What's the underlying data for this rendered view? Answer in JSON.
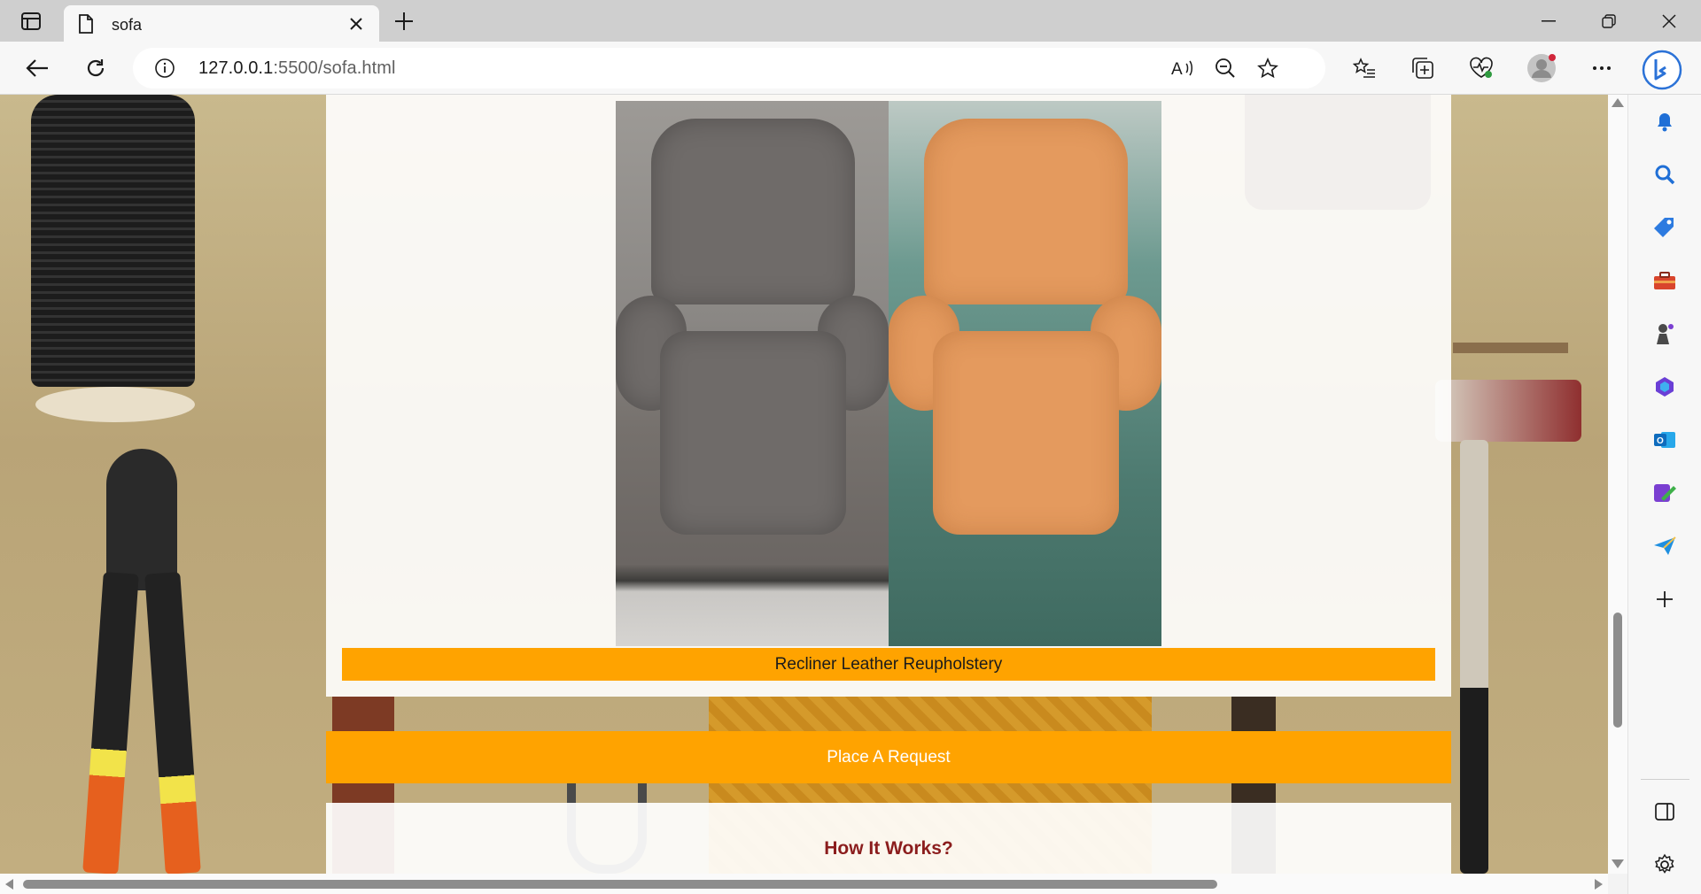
{
  "browser": {
    "tab_title": "sofa",
    "url_host": "127.0.0.1",
    "url_path": ":5500/sofa.html",
    "icons": {
      "tab_actions": "tab-actions-icon",
      "favicon": "page-icon",
      "close_tab": "close-icon",
      "new_tab": "plus-icon",
      "back": "back-arrow-icon",
      "refresh": "refresh-icon",
      "site_info": "info-icon",
      "read_aloud": "read-aloud-icon",
      "zoom": "zoom-out-icon",
      "favorite": "star-icon",
      "favorites": "favorites-icon",
      "collections": "collections-icon",
      "performance": "heartbeat-icon",
      "profile": "profile-icon",
      "more": "more-icon",
      "bing": "bing-copilot-icon"
    },
    "window_controls": [
      "minimize-icon",
      "restore-icon",
      "close-icon"
    ]
  },
  "sidebar": {
    "items": [
      "bell-icon",
      "search-icon",
      "tag-icon",
      "toolbox-icon",
      "games-icon",
      "office-icon",
      "outlook-icon",
      "designer-icon",
      "send-icon",
      "add-icon",
      "split-screen-icon",
      "settings-icon"
    ]
  },
  "page": {
    "caption": "Recliner Leather Reupholstery",
    "request_button": "Place A Request",
    "how_title": "How It Works?"
  },
  "colors": {
    "accent": "#ffa300",
    "heading": "#8b1d1d"
  }
}
